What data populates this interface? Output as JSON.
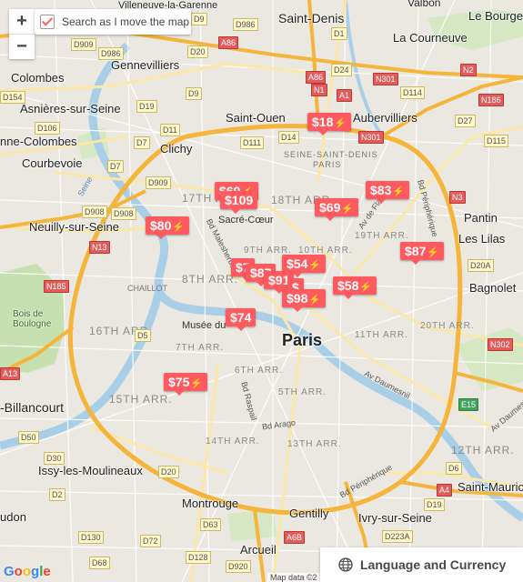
{
  "map": {
    "cities": [
      {
        "id": "saint-denis",
        "text": "Saint-Denis"
      },
      {
        "id": "villeneuve",
        "text": "Villeneuve-la-Garenne"
      },
      {
        "id": "la-courneuve",
        "text": "La Courneuve"
      },
      {
        "id": "colombes",
        "text": "Colombes"
      },
      {
        "id": "gennevilliers",
        "text": "Gennevilliers"
      },
      {
        "id": "asnieres",
        "text": "Asnières-sur-Seine"
      },
      {
        "id": "saint-ouen",
        "text": "Saint-Ouen"
      },
      {
        "id": "aubervilliers",
        "text": "Aubervilliers"
      },
      {
        "id": "la-garenne",
        "text": "nne-Colombes"
      },
      {
        "id": "clichy",
        "text": "Clichy"
      },
      {
        "id": "courbevoie",
        "text": "Courbevoie"
      },
      {
        "id": "neuilly",
        "text": "Neuilly-sur-Seine"
      },
      {
        "id": "pantin",
        "text": "Pantin"
      },
      {
        "id": "les-lilas",
        "text": "Les Lilas"
      },
      {
        "id": "bagnolet",
        "text": "Bagnolet"
      },
      {
        "id": "billancourt",
        "text": "-Billancourt"
      },
      {
        "id": "issy",
        "text": "Issy-les-Moulineaux"
      },
      {
        "id": "montrouge",
        "text": "Montrouge"
      },
      {
        "id": "gentilly",
        "text": "Gentilly"
      },
      {
        "id": "ivry",
        "text": "Ivry-sur-Seine"
      },
      {
        "id": "saint-maurice",
        "text": "Saint-Mauric"
      },
      {
        "id": "arcueil",
        "text": "Arcueil"
      },
      {
        "id": "udon",
        "text": "udon"
      },
      {
        "id": "le-bourget",
        "text": "Le Bourget"
      },
      {
        "id": "valbon",
        "text": "Valbon"
      },
      {
        "id": "bois-boulogne",
        "text": "Bois de\nBoulogne"
      },
      {
        "id": "chaillot",
        "text": "CHAILLOT"
      },
      {
        "id": "sacre-coeur",
        "text": "Sacré-Cœur"
      },
      {
        "id": "musee",
        "text": "Musée du"
      },
      {
        "id": "ssd",
        "text": "SEINE-SAINT-DENIS"
      },
      {
        "id": "paris-dept",
        "text": "PARIS"
      }
    ],
    "paris": "Paris",
    "arrondissements": [
      {
        "id": "a17",
        "text": "17TH ARR."
      },
      {
        "id": "a18",
        "text": "18TH ARR."
      },
      {
        "id": "a9",
        "text": "9TH ARR."
      },
      {
        "id": "a10",
        "text": "10TH ARR."
      },
      {
        "id": "a8",
        "text": "8TH ARR."
      },
      {
        "id": "a19",
        "text": "19TH ARR."
      },
      {
        "id": "a16",
        "text": "16TH ARR."
      },
      {
        "id": "a7",
        "text": "7TH ARR."
      },
      {
        "id": "a11",
        "text": "11TH ARR."
      },
      {
        "id": "a20",
        "text": "20TH ARR."
      },
      {
        "id": "a6",
        "text": "6TH ARR."
      },
      {
        "id": "a5",
        "text": "5TH ARR."
      },
      {
        "id": "a15",
        "text": "15TH ARR."
      },
      {
        "id": "a14",
        "text": "14TH ARR."
      },
      {
        "id": "a13",
        "text": "13TH ARR."
      },
      {
        "id": "a12",
        "text": "12TH ARR."
      }
    ],
    "streets": [
      {
        "id": "seine1",
        "text": "Seine"
      },
      {
        "id": "malesherbes",
        "text": "Bd Malesherbes"
      },
      {
        "id": "flandre",
        "text": "Av de Fla"
      },
      {
        "id": "bdperiph",
        "text": "Bd Périphérique"
      },
      {
        "id": "bdperiph2",
        "text": "Bd Périphérique"
      },
      {
        "id": "raspail",
        "text": "Bd Raspail"
      },
      {
        "id": "arago",
        "text": "Bd Arago"
      },
      {
        "id": "daumesnil1",
        "text": "Av Daumesnil"
      },
      {
        "id": "daumesnil2",
        "text": "Av Daumesnil"
      }
    ],
    "roads": [
      {
        "id": "r1",
        "text": "D909"
      },
      {
        "id": "r2",
        "text": "D986"
      },
      {
        "id": "r3",
        "text": "D20"
      },
      {
        "id": "r4",
        "text": "D986"
      },
      {
        "id": "r5",
        "text": "A86",
        "red": true
      },
      {
        "id": "r6",
        "text": "A86",
        "red": true
      },
      {
        "id": "r7",
        "text": "A1",
        "red": true
      },
      {
        "id": "r8",
        "text": "N1",
        "red": true
      },
      {
        "id": "r9",
        "text": "D24"
      },
      {
        "id": "r10",
        "text": "N301",
        "red": true
      },
      {
        "id": "r11",
        "text": "D114"
      },
      {
        "id": "r12",
        "text": "N2",
        "red": true
      },
      {
        "id": "r13",
        "text": "N186",
        "red": true
      },
      {
        "id": "r14",
        "text": "D9"
      },
      {
        "id": "r15",
        "text": "D19"
      },
      {
        "id": "r16",
        "text": "D106"
      },
      {
        "id": "r17",
        "text": "D7"
      },
      {
        "id": "r18",
        "text": "D11"
      },
      {
        "id": "r19",
        "text": "D111"
      },
      {
        "id": "r20",
        "text": "D14"
      },
      {
        "id": "r21",
        "text": "N301",
        "red": true
      },
      {
        "id": "r22",
        "text": "D27"
      },
      {
        "id": "r23",
        "text": "D115"
      },
      {
        "id": "r24",
        "text": "D909"
      },
      {
        "id": "r25",
        "text": "D908"
      },
      {
        "id": "r26",
        "text": "N3",
        "red": true
      },
      {
        "id": "r27",
        "text": "N13",
        "red": true
      },
      {
        "id": "r28",
        "text": "N185",
        "red": true
      },
      {
        "id": "r29",
        "text": "D20A"
      },
      {
        "id": "r30",
        "text": "N302",
        "red": true
      },
      {
        "id": "r31",
        "text": "A13",
        "red": true
      },
      {
        "id": "r32",
        "text": "E15",
        "green": true
      },
      {
        "id": "r33",
        "text": "D50"
      },
      {
        "id": "r34",
        "text": "D2"
      },
      {
        "id": "r35",
        "text": "D6"
      },
      {
        "id": "r36",
        "text": "A4",
        "red": true
      },
      {
        "id": "r37",
        "text": "D19"
      },
      {
        "id": "r38",
        "text": "D63"
      },
      {
        "id": "r39",
        "text": "D130"
      },
      {
        "id": "r40",
        "text": "D72"
      },
      {
        "id": "r41",
        "text": "D68"
      },
      {
        "id": "r42",
        "text": "D128"
      },
      {
        "id": "r43",
        "text": "D920"
      },
      {
        "id": "r44",
        "text": "A6B",
        "red": true
      },
      {
        "id": "r45",
        "text": "D223A"
      },
      {
        "id": "r46",
        "text": "D20"
      },
      {
        "id": "r47",
        "text": "D5"
      },
      {
        "id": "r48",
        "text": "D154"
      },
      {
        "id": "r49",
        "text": "D7"
      },
      {
        "id": "r50",
        "text": "D1"
      },
      {
        "id": "r51",
        "text": "D9"
      },
      {
        "id": "r52",
        "text": "D908"
      },
      {
        "id": "r53",
        "text": "D30"
      }
    ]
  },
  "listings": [
    {
      "id": "m18",
      "price": "$18"
    },
    {
      "id": "m83",
      "price": "$83"
    },
    {
      "id": "m69a",
      "price": "$69"
    },
    {
      "id": "m109",
      "price": "$109"
    },
    {
      "id": "m69b",
      "price": "$69"
    },
    {
      "id": "m80",
      "price": "$80"
    },
    {
      "id": "m87",
      "price": "$87"
    },
    {
      "id": "m54",
      "price": "$54"
    },
    {
      "id": "m7x",
      "price": "$7"
    },
    {
      "id": "m8x",
      "price": "$87"
    },
    {
      "id": "m91",
      "price": "$91"
    },
    {
      "id": "m58",
      "price": "$58"
    },
    {
      "id": "mstack",
      "price": "$"
    },
    {
      "id": "m98",
      "price": "$98"
    },
    {
      "id": "m74",
      "price": "$74"
    },
    {
      "id": "m75",
      "price": "$75"
    }
  ],
  "controls": {
    "zoom_in": "+",
    "zoom_out": "−",
    "search_as_move": "Search as I move the map",
    "search_as_move_checked": true,
    "language_currency": "Language and Currency",
    "map_data": "Map data ©2",
    "google": "Google"
  },
  "colors": {
    "marker": "#ff5a5f",
    "highway": "#f5b43a",
    "water": "#a9cfe8",
    "park": "#c6e0b0"
  },
  "icons": {
    "globe": "globe-icon",
    "checkbox": "checkbox-checked-icon",
    "instant": "lightning-bolt-icon"
  }
}
